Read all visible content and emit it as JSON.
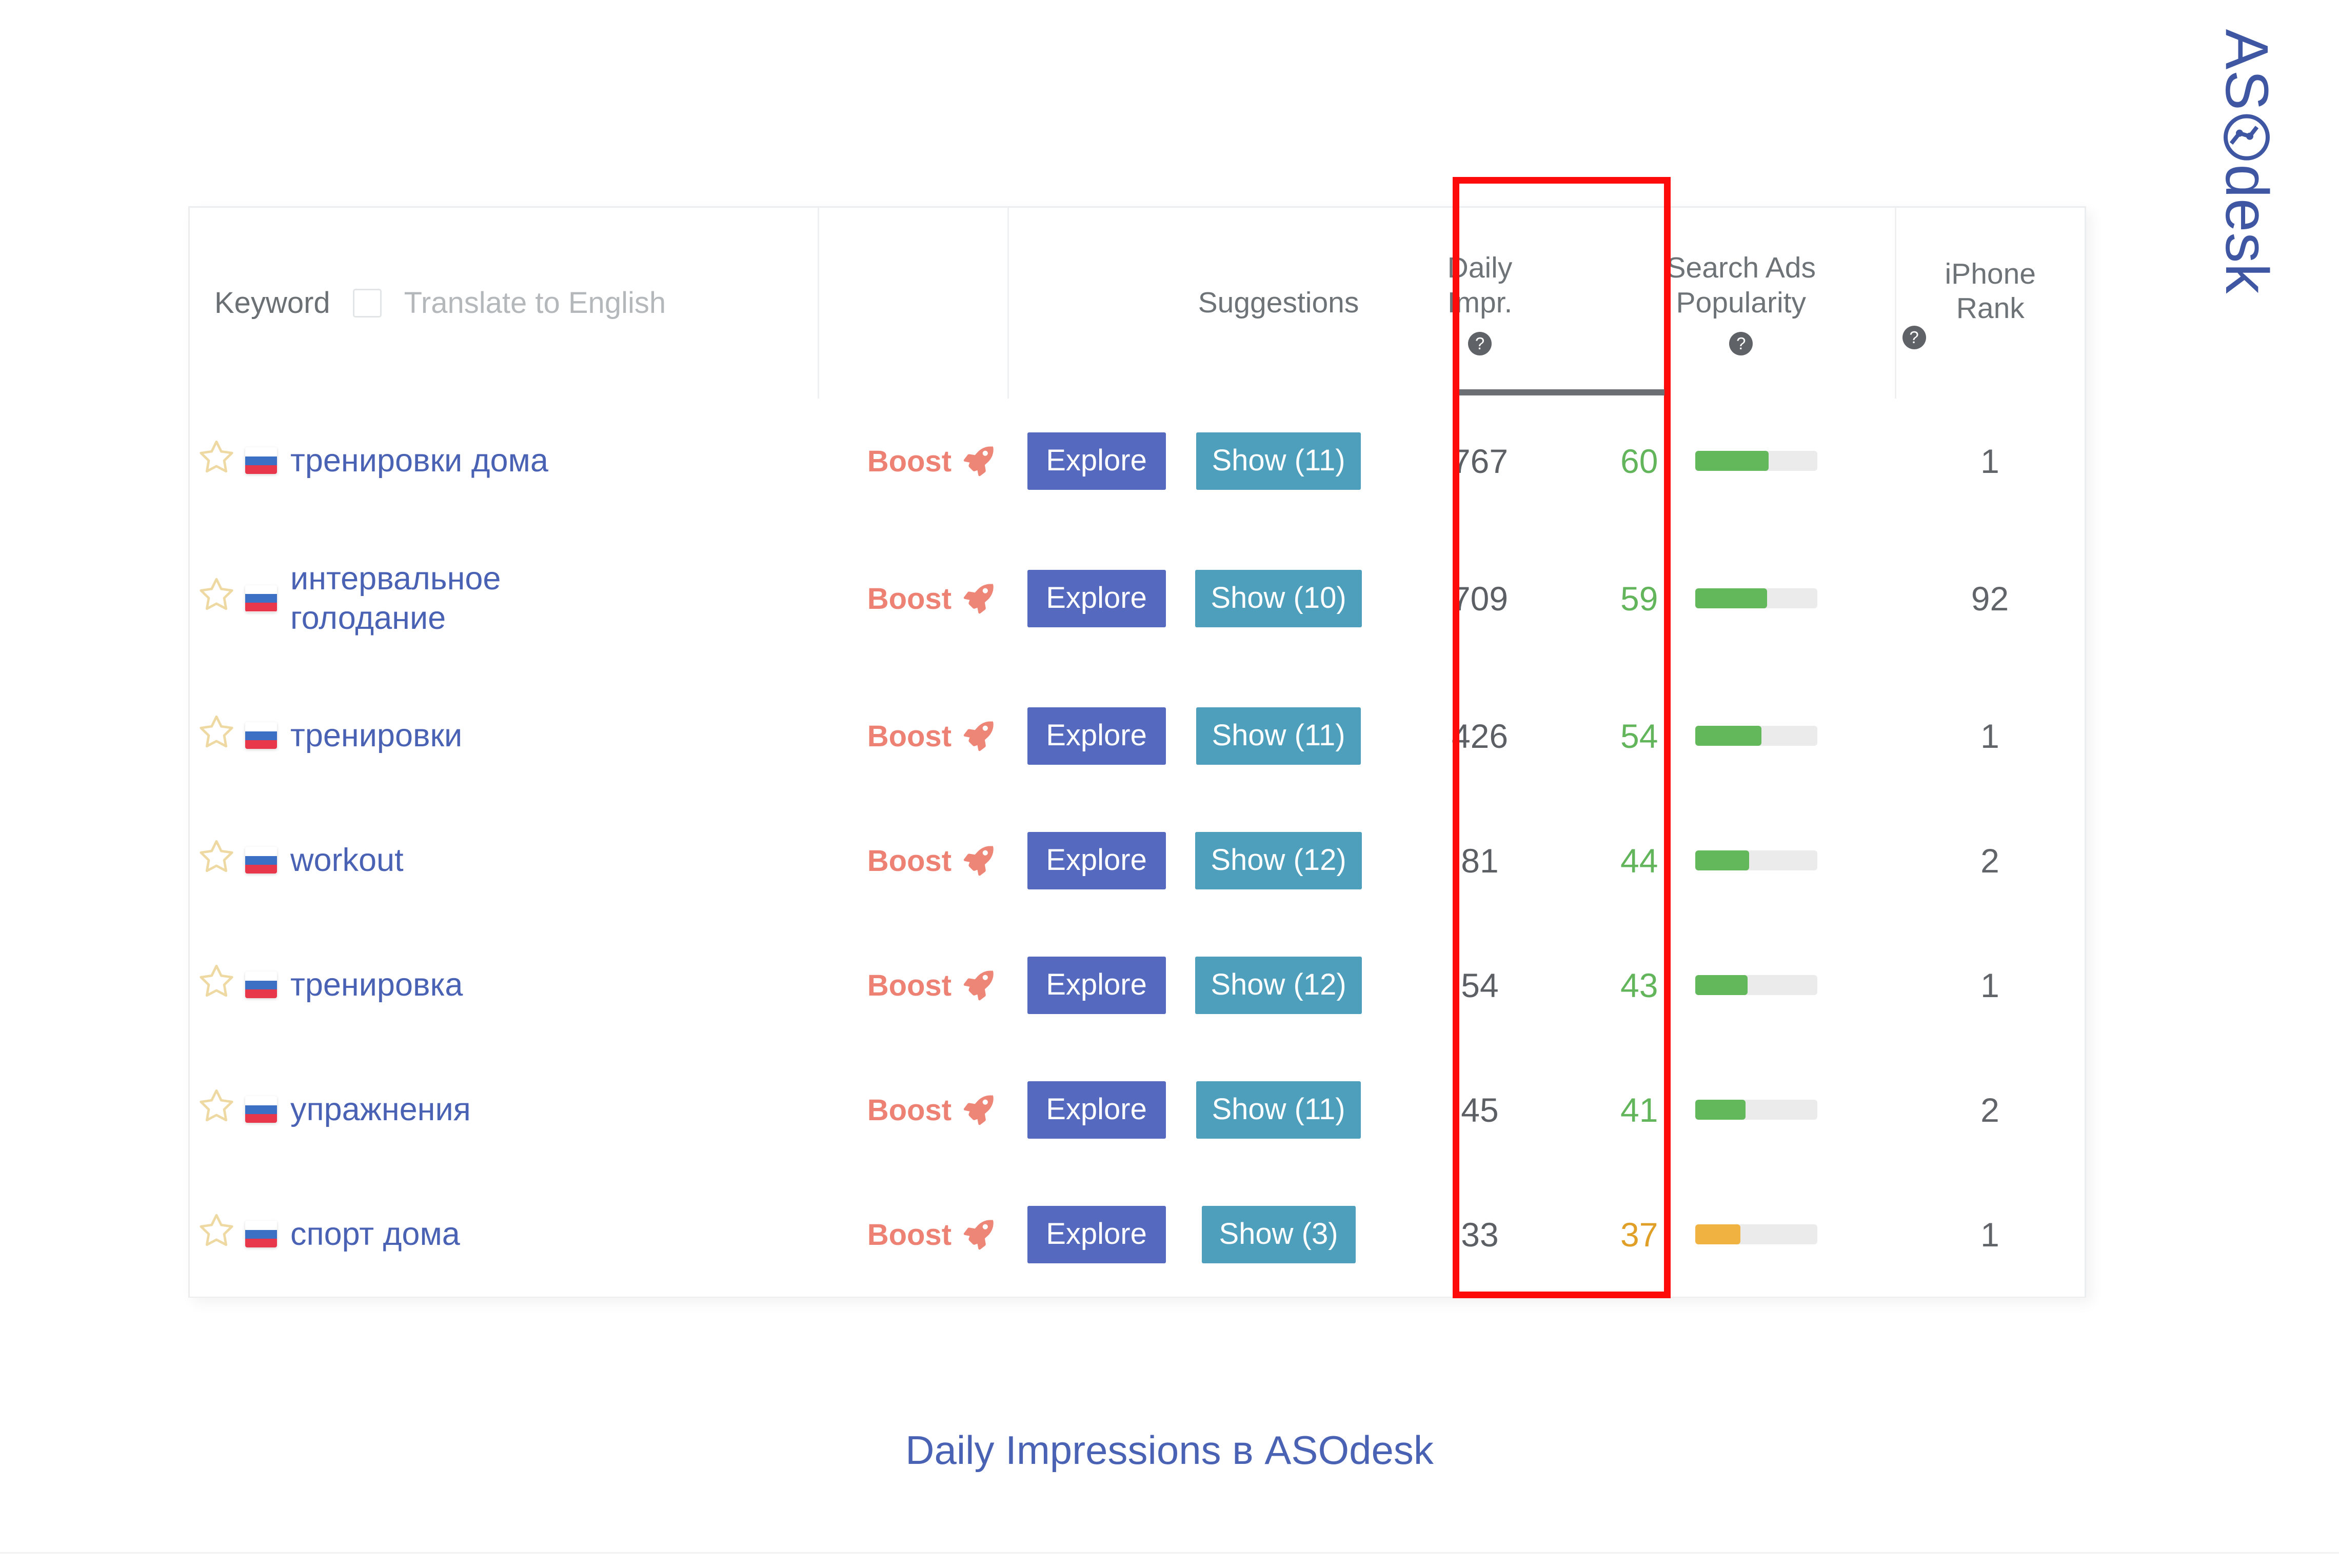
{
  "brand": {
    "logo_text_before": "AS",
    "logo_icon": "globe-o-icon",
    "logo_text_after": "desk",
    "accent_color": "#3F56A3"
  },
  "caption": "Daily Impressions в ASOdesk",
  "highlight": {
    "column": "Daily Impr.",
    "border_color": "#FD0A0A"
  },
  "table": {
    "header": {
      "keyword_label": "Keyword",
      "translate_label": "Translate to English",
      "translate_checked": false,
      "suggestions_label": "Suggestions",
      "daily_impr_line1": "Daily",
      "daily_impr_line2": "Impr.",
      "search_ads_line1": "Search Ads",
      "search_ads_line2": "Popularity",
      "iphone_rank_line1": "iPhone",
      "iphone_rank_line2": "Rank",
      "help_icon": "question-mark-circle-icon",
      "help_glyph": "?"
    },
    "colors": {
      "explore_button": "#5569BE",
      "show_button": "#4E9FBC",
      "boost_text": "#ED8274",
      "keyword_text": "#4A62B4",
      "popularity_green": "#63B85C",
      "popularity_orange": "#F0B342",
      "track": "#EBEBEB"
    },
    "rows": [
      {
        "star_icon": "star-outline-icon",
        "flag_icon": "flag-ru-icon",
        "keyword": "тренировки дома",
        "boost_label": "Boost",
        "boost_icon": "rocket-icon",
        "explore_label": "Explore",
        "show_label": "Show (11)",
        "daily_impr": "767",
        "search_ads_popularity": "60",
        "search_ads_fill_pct": 60,
        "search_ads_color": "green",
        "iphone_rank": "1",
        "two_line": false
      },
      {
        "star_icon": "star-outline-icon",
        "flag_icon": "flag-ru-icon",
        "keyword": "интервальное голодание",
        "boost_label": "Boost",
        "boost_icon": "rocket-icon",
        "explore_label": "Explore",
        "show_label": "Show (10)",
        "daily_impr": "709",
        "search_ads_popularity": "59",
        "search_ads_fill_pct": 59,
        "search_ads_color": "green",
        "iphone_rank": "92",
        "two_line": true
      },
      {
        "star_icon": "star-outline-icon",
        "flag_icon": "flag-ru-icon",
        "keyword": "тренировки",
        "boost_label": "Boost",
        "boost_icon": "rocket-icon",
        "explore_label": "Explore",
        "show_label": "Show (11)",
        "daily_impr": "426",
        "search_ads_popularity": "54",
        "search_ads_fill_pct": 54,
        "search_ads_color": "green",
        "iphone_rank": "1",
        "two_line": false
      },
      {
        "star_icon": "star-outline-icon",
        "flag_icon": "flag-ru-icon",
        "keyword": "workout",
        "boost_label": "Boost",
        "boost_icon": "rocket-icon",
        "explore_label": "Explore",
        "show_label": "Show (12)",
        "daily_impr": "81",
        "search_ads_popularity": "44",
        "search_ads_fill_pct": 44,
        "search_ads_color": "green",
        "iphone_rank": "2",
        "two_line": false
      },
      {
        "star_icon": "star-outline-icon",
        "flag_icon": "flag-ru-icon",
        "keyword": "тренировка",
        "boost_label": "Boost",
        "boost_icon": "rocket-icon",
        "explore_label": "Explore",
        "show_label": "Show (12)",
        "daily_impr": "54",
        "search_ads_popularity": "43",
        "search_ads_fill_pct": 43,
        "search_ads_color": "green",
        "iphone_rank": "1",
        "two_line": false
      },
      {
        "star_icon": "star-outline-icon",
        "flag_icon": "flag-ru-icon",
        "keyword": "упражнения",
        "boost_label": "Boost",
        "boost_icon": "rocket-icon",
        "explore_label": "Explore",
        "show_label": "Show (11)",
        "daily_impr": "45",
        "search_ads_popularity": "41",
        "search_ads_fill_pct": 41,
        "search_ads_color": "green",
        "iphone_rank": "2",
        "two_line": false
      },
      {
        "star_icon": "star-outline-icon",
        "flag_icon": "flag-ru-icon",
        "keyword": "спорт дома",
        "boost_label": "Boost",
        "boost_icon": "rocket-icon",
        "explore_label": "Explore",
        "show_label": "Show (3)",
        "daily_impr": "33",
        "search_ads_popularity": "37",
        "search_ads_fill_pct": 37,
        "search_ads_color": "orange",
        "iphone_rank": "1",
        "two_line": false
      }
    ]
  }
}
